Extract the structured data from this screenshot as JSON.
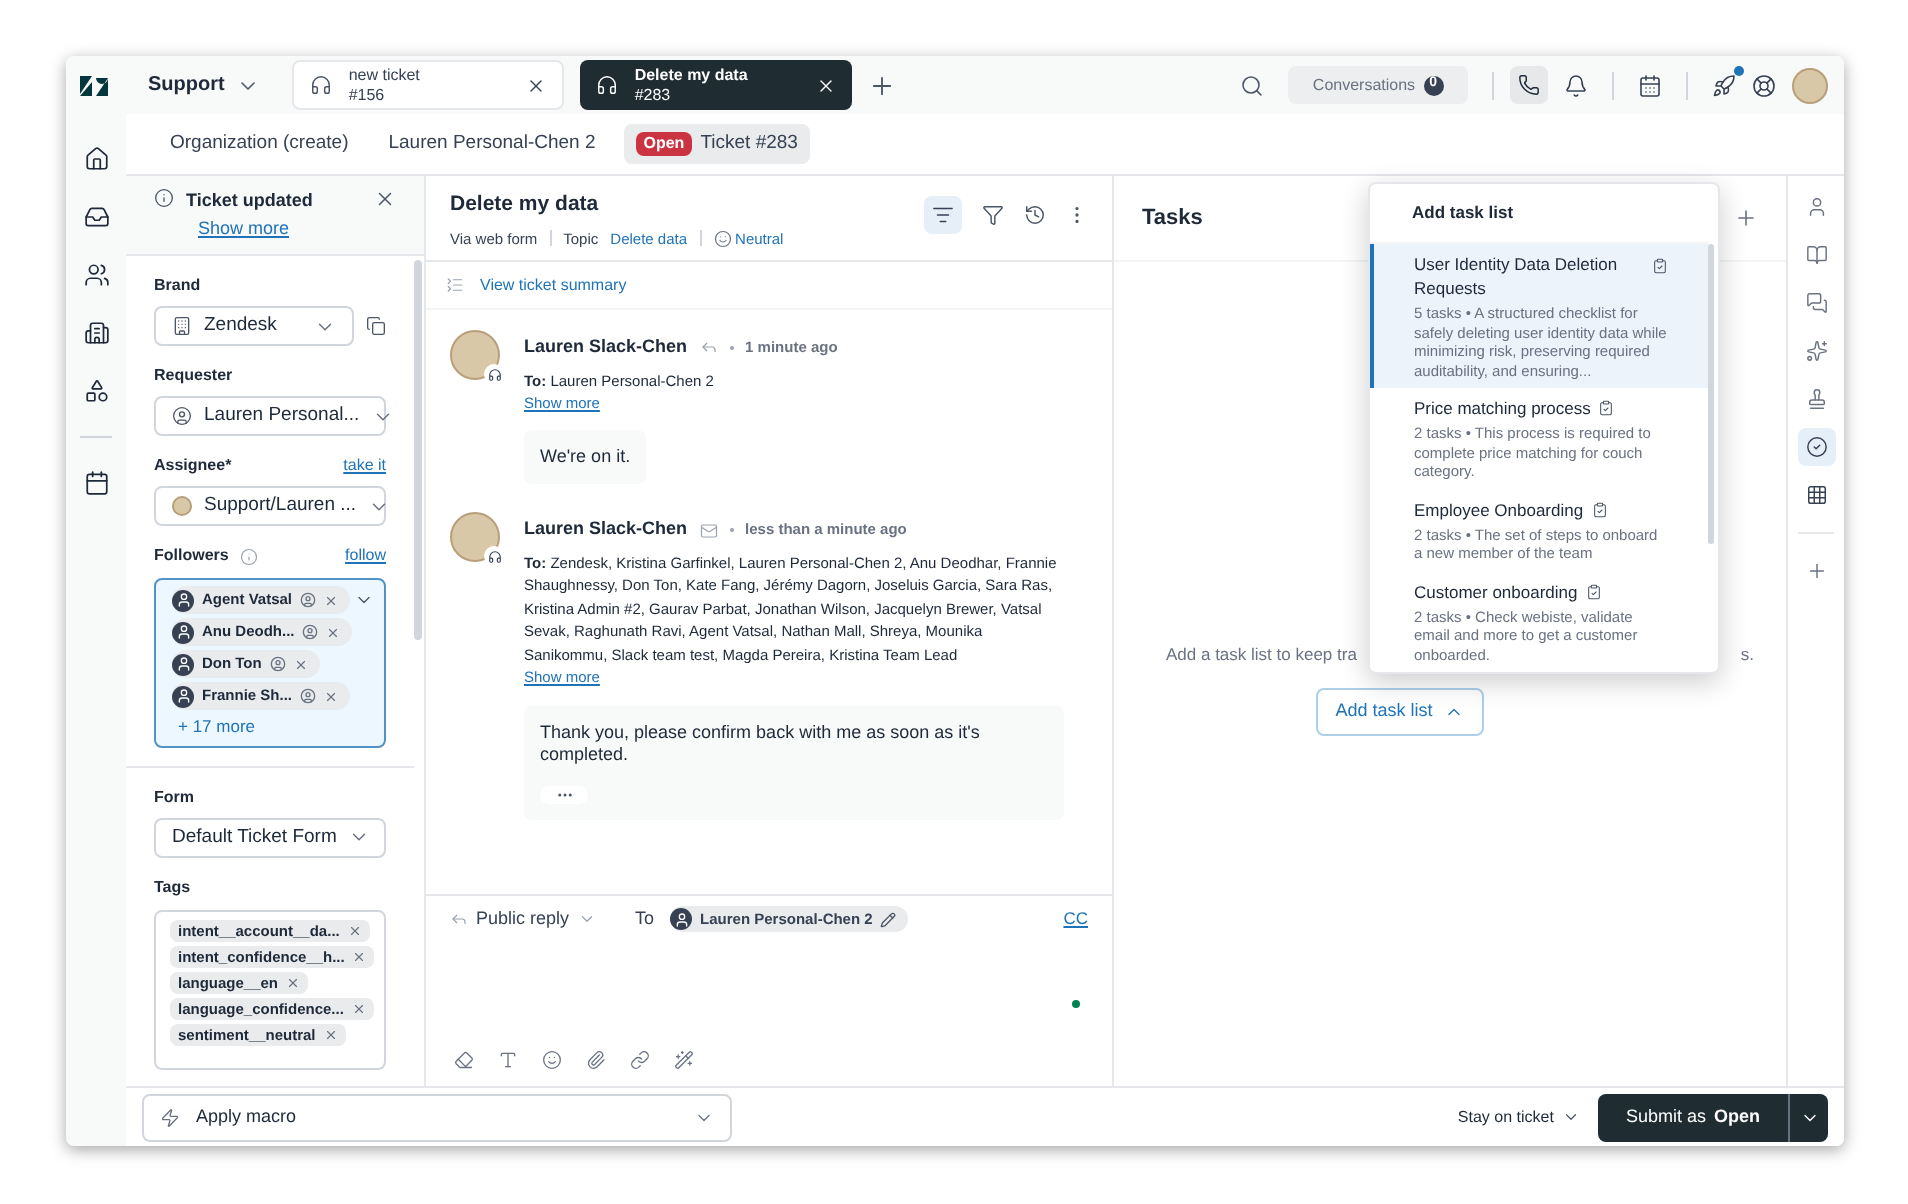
{
  "top_bar": {
    "product": "Support",
    "tabs": [
      {
        "title": "new ticket",
        "subtitle": "#156",
        "selected": false
      },
      {
        "title": "Delete my data",
        "subtitle": "#283",
        "selected": true
      }
    ],
    "conversations": {
      "label": "Conversations",
      "count": "0"
    }
  },
  "sub_tabs": [
    {
      "label": "Organization (create)",
      "selected": false
    },
    {
      "label": "Lauren Personal-Chen 2",
      "selected": false
    },
    {
      "badge": "Open",
      "label": "Ticket #283",
      "selected": true
    }
  ],
  "notice": {
    "title": "Ticket updated",
    "link": "Show more"
  },
  "properties": {
    "brand": {
      "label": "Brand",
      "value": "Zendesk"
    },
    "requester": {
      "label": "Requester",
      "value": "Lauren Personal..."
    },
    "assignee": {
      "label": "Assignee*",
      "link": "take it",
      "value": "Support/Lauren ..."
    },
    "followers": {
      "label": "Followers",
      "link": "follow",
      "chips": [
        "Agent Vatsal",
        "Anu Deodh...",
        "Don Ton",
        "Frannie Sh..."
      ],
      "more": "+ 17 more"
    },
    "form": {
      "label": "Form",
      "value": "Default Ticket Form"
    },
    "tags": {
      "label": "Tags",
      "items": [
        "intent__account__da...",
        "intent_confidence__h...",
        "language__en",
        "language_confidence...",
        "sentiment__neutral"
      ]
    }
  },
  "conversation": {
    "title": "Delete my data",
    "via": "Via web form",
    "topic_label": "Topic",
    "topic": "Delete data",
    "sentiment": "Neutral",
    "summary_link": "View ticket summary",
    "messages": [
      {
        "author": "Lauren Slack-Chen",
        "kind": "reply",
        "time": "1 minute ago",
        "to_label": "To:",
        "to": "Lauren Personal-Chen 2",
        "show_more": "Show more",
        "body": "We're on it.",
        "more_button": false
      },
      {
        "author": "Lauren Slack-Chen",
        "kind": "email",
        "time": "less than a minute ago",
        "to_label": "To:",
        "to": "Zendesk, Kristina Garfinkel, Lauren Personal-Chen 2, Anu Deodhar, Frannie Shaughnessy, Don Ton, Kate Fang, Jérémy Dagorn, Joseluis Garcia, Sara Ras, Kristina Admin #2, Gaurav Parbat, Jonathan Wilson, Jacquelyn Brewer, Vatsal Sevak, Raghunath Ravi, Agent Vatsal, Nathan Mall, Shreya, Mounika Sanikommu, Slack team test, Magda Pereira, Kristina Team Lead",
        "show_more": "Show more",
        "body": "Thank you, please confirm back with me as soon as it's completed.",
        "more_button": true
      }
    ]
  },
  "composer": {
    "mode": "Public reply",
    "to_label": "To",
    "recipient": "Lauren Personal-Chen 2",
    "cc": "CC"
  },
  "tasks": {
    "title": "Tasks",
    "empty_left": "Add a task list to keep tra",
    "empty_right": "s.",
    "button": "Add task list",
    "dropdown": {
      "title": "Add task list",
      "items": [
        {
          "name": "User Identity Data Deletion Requests",
          "description": "5 tasks • A structured checklist for safely deleting user identity data while minimizing risk, preserving required auditability, and ensuring...",
          "selected": true
        },
        {
          "name": "Price matching process",
          "description": "2 tasks • This process is required to complete price matching for couch category.",
          "selected": false
        },
        {
          "name": "Employee Onboarding",
          "description": "2 tasks • The set of steps to onboard a new member of the team",
          "selected": false
        },
        {
          "name": "Customer onboarding",
          "description": "2 tasks • Check webiste, validate email and more to get a customer onboarded.",
          "selected": false
        }
      ]
    }
  },
  "bottom_bar": {
    "macro": "Apply macro",
    "stay": "Stay on ticket",
    "submit_label": "Submit as",
    "submit_status": "Open"
  }
}
